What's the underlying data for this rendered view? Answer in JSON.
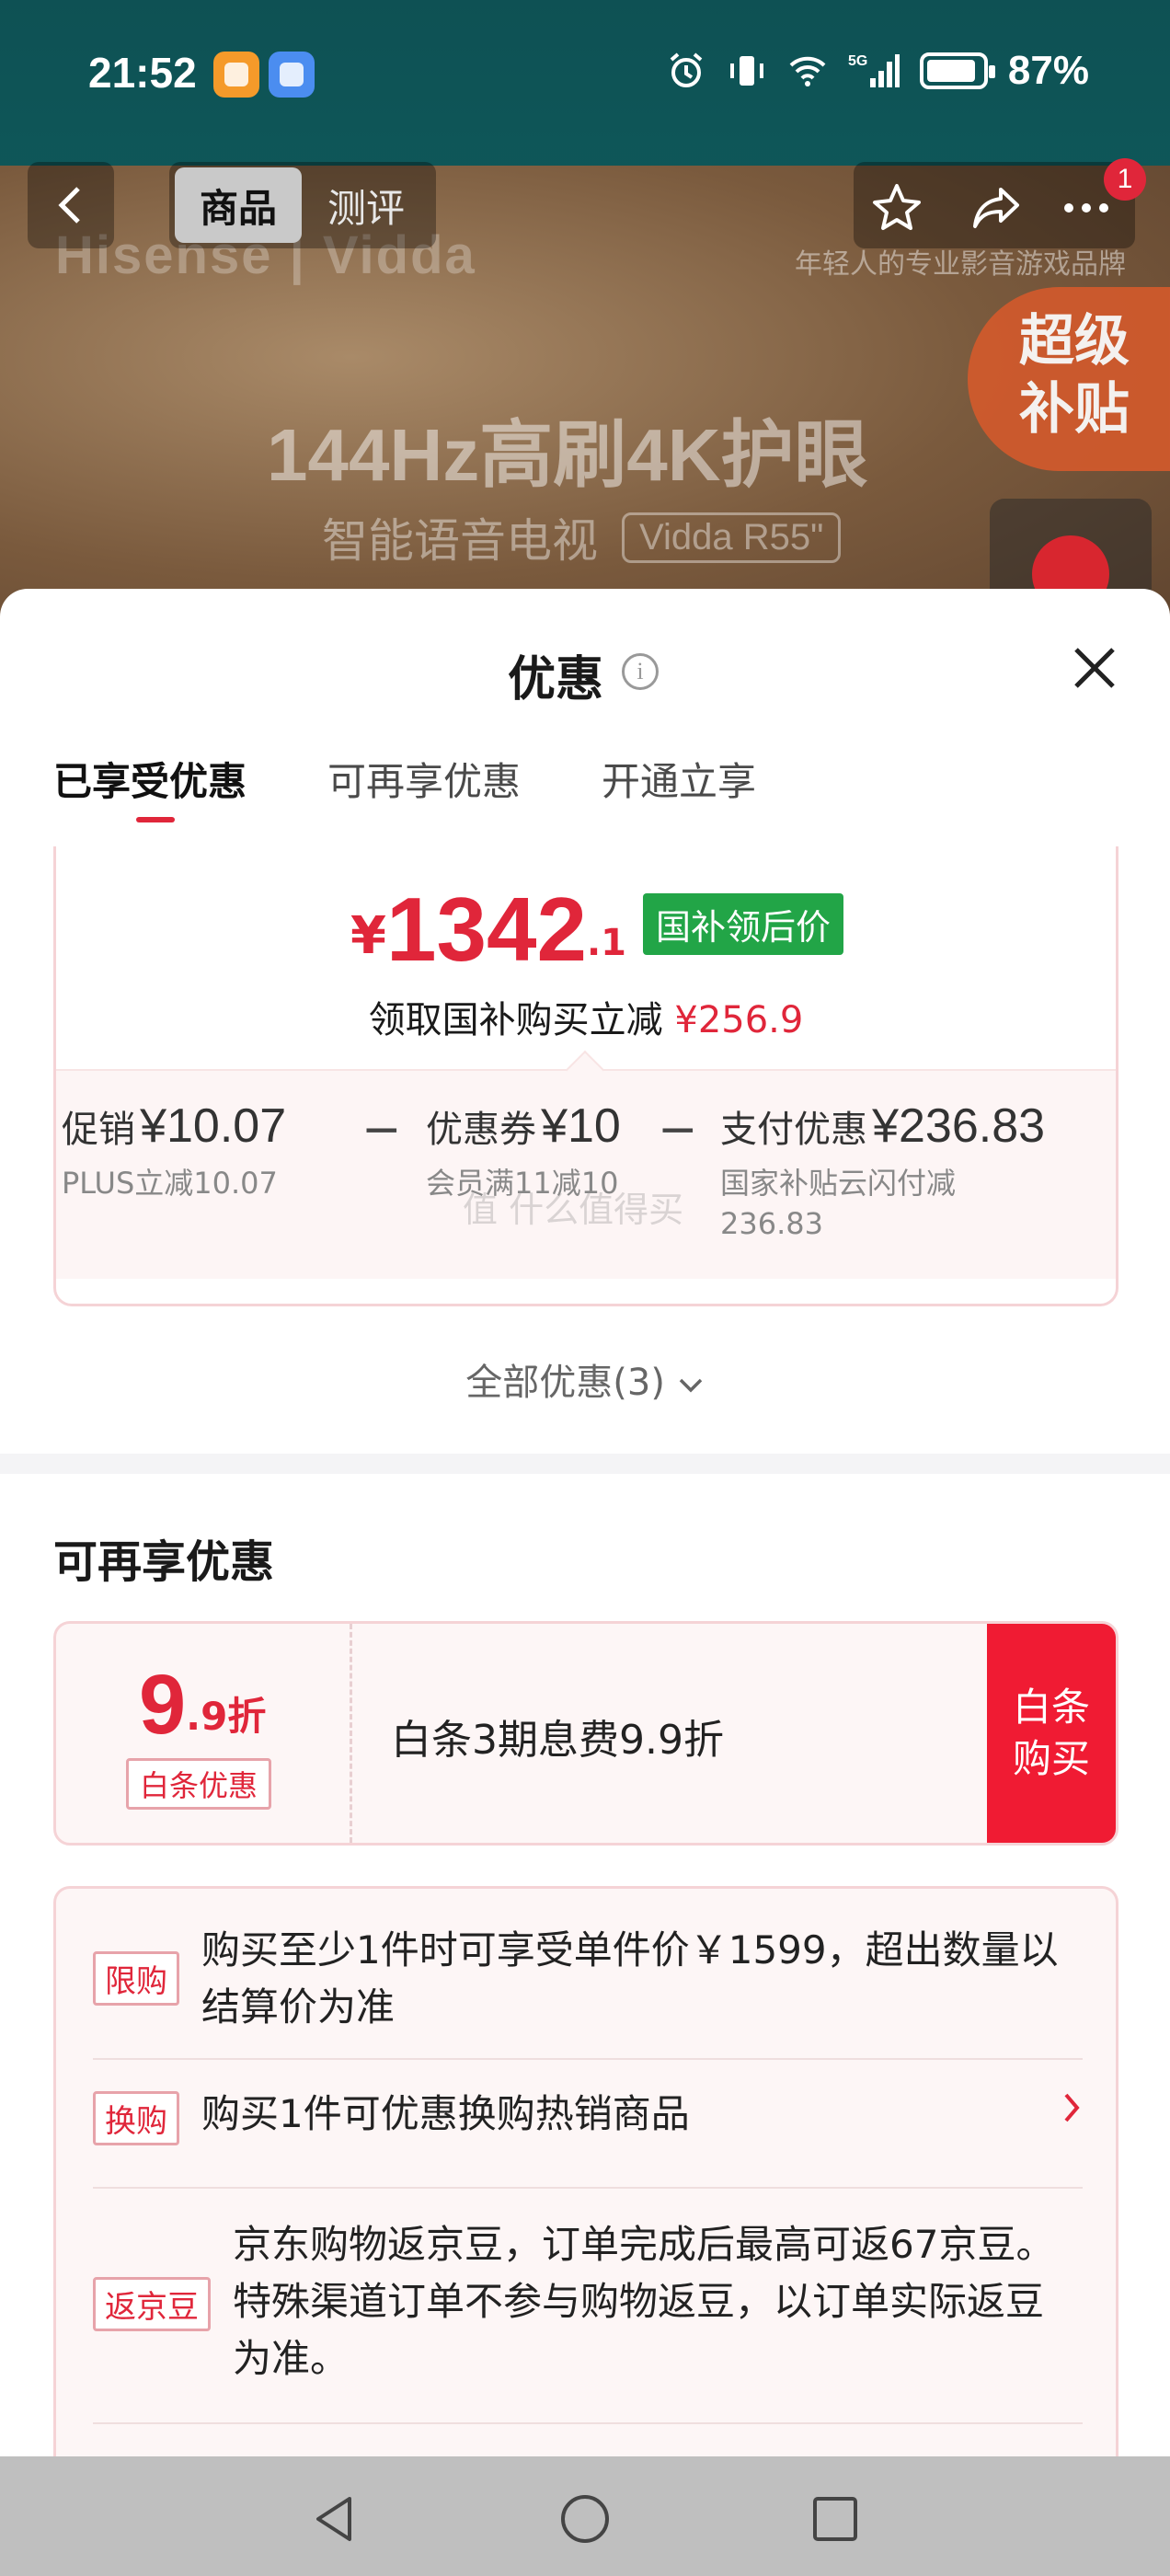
{
  "status_bar": {
    "time": "21:52",
    "network": "5G",
    "battery": "87%"
  },
  "nav": {
    "tab_product": "商品",
    "tab_review": "测评",
    "notification_count": "1"
  },
  "hero": {
    "brand": "Hisense | Vidda",
    "slogan": "年轻人的专业影音游戏品牌",
    "title": "144Hz高刷4K护眼",
    "subtitle": "智能语音电视",
    "model": "Vidda R55\"",
    "super_subsidy": [
      "超级",
      "补贴"
    ]
  },
  "sheet": {
    "title": "优惠",
    "tabs": [
      "已享受优惠",
      "可再享优惠",
      "开通立享"
    ],
    "active_tab": 0
  },
  "summary": {
    "currency": "¥",
    "price_int": "1342",
    "price_dec": ".1",
    "price_tag": "国补领后价",
    "save_label": "领取国补购买立减",
    "save_amount": "¥256.9",
    "breakdown": [
      {
        "label": "促销",
        "amount": "¥10.07",
        "note": "PLUS立减10.07"
      },
      {
        "label": "优惠券",
        "amount": "¥10",
        "note": "会员满11减10"
      },
      {
        "label": "支付优惠",
        "amount": "¥236.83",
        "note": "国家补贴云闪付减",
        "note2": "236.83"
      }
    ],
    "minus": "−",
    "watermark": "值 什么值得买"
  },
  "all_offers": "全部优惠(3)",
  "section2": {
    "title": "可再享优惠",
    "baitiao": {
      "discount_num": "9",
      "discount_suffix": ".9折",
      "tag": "白条优惠",
      "text": "白条3期息费9.9折",
      "button": [
        "白条",
        "购买"
      ]
    }
  },
  "rules": [
    {
      "tag": "限购",
      "text": [
        "购买至少1件时可享受单件价￥1599，超出数量以",
        "结算价为准"
      ]
    },
    {
      "tag": "换购",
      "text": [
        "购买1件可优惠换购热销商品"
      ],
      "has_arrow": true
    },
    {
      "tag": "返京豆",
      "text": [
        "京东购物返京豆，订单完成后最高可返67京豆。",
        "特殊渠道订单不参与购物返豆，以订单实际返豆",
        "为准。"
      ]
    }
  ],
  "colors": {
    "accent_red": "#e0263a",
    "button_red": "#f01b33",
    "tag_green": "#22a547"
  }
}
